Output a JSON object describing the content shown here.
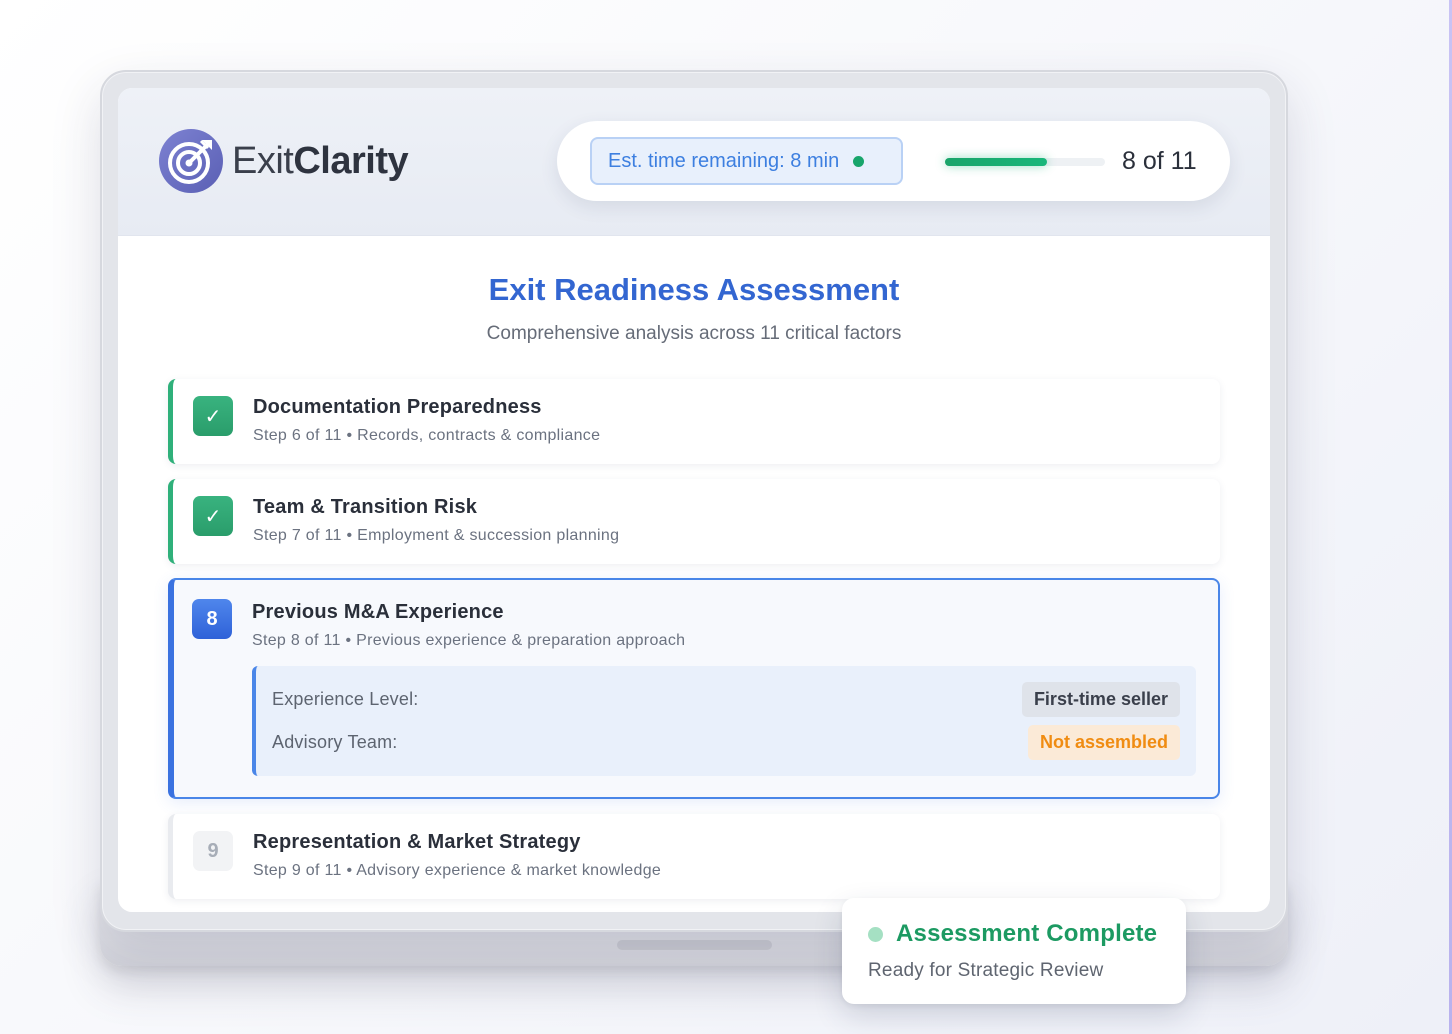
{
  "brand": {
    "name_light": "Exit",
    "name_bold": "Clarity"
  },
  "header": {
    "time_remaining": "Est. time remaining: 8 min",
    "progress_fraction": 0.64,
    "step_count": "8 of 11"
  },
  "main": {
    "title": "Exit Readiness Assessment",
    "subtitle": "Comprehensive analysis across 11 critical factors"
  },
  "steps": [
    {
      "status": "complete",
      "badge": "✓",
      "title": "Documentation Preparedness",
      "subtitle": "Step 6 of 11 • Records, contracts & compliance"
    },
    {
      "status": "complete",
      "badge": "✓",
      "title": "Team & Transition Risk",
      "subtitle": "Step 7 of 11 • Employment & succession planning"
    },
    {
      "status": "active",
      "badge": "8",
      "title": "Previous M&A Experience",
      "subtitle": "Step 8 of 11 • Previous experience & preparation approach",
      "details": [
        {
          "label": "Experience Level:",
          "value": "First-time seller"
        },
        {
          "label": "Advisory Team:",
          "value": "Not assembled"
        }
      ]
    },
    {
      "status": "pending",
      "badge": "9",
      "title": "Representation & Market Strategy",
      "subtitle": "Step 9 of 11 • Advisory experience & market knowledge"
    }
  ],
  "toast": {
    "title": "Assessment Complete",
    "subtitle": "Ready for Strategic Review"
  },
  "colors": {
    "accent_blue": "#3366d1",
    "success_green": "#1c9a62",
    "warning_orange": "#f08c12",
    "logo_purple": "#6b6fc0"
  },
  "icons": {
    "logo": "target-arrow-icon",
    "complete": "check-icon",
    "status_dot": "status-dot-icon"
  }
}
